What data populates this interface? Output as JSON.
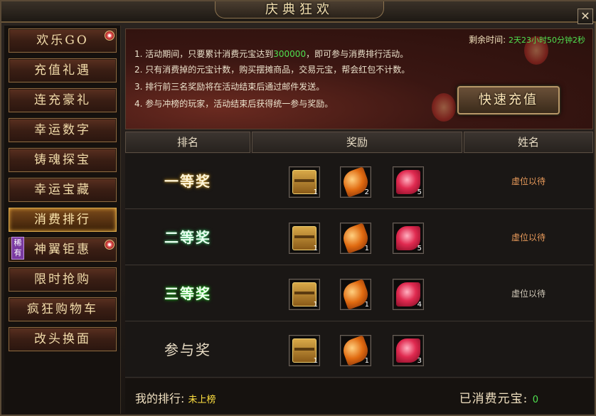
{
  "window": {
    "title": "庆典狂欢",
    "close_label": "✕"
  },
  "sidebar": {
    "items": [
      {
        "label": "欢乐GO",
        "dot": true
      },
      {
        "label": "充值礼遇"
      },
      {
        "label": "连充豪礼"
      },
      {
        "label": "幸运数字"
      },
      {
        "label": "铸魂探宝"
      },
      {
        "label": "幸运宝藏"
      },
      {
        "label": "消费排行",
        "active": true
      },
      {
        "label": "神翼钜惠",
        "dot": true,
        "tag": "稀有"
      },
      {
        "label": "限时抢购"
      },
      {
        "label": "疯狂购物车"
      },
      {
        "label": "改头换面"
      }
    ]
  },
  "banner": {
    "rules": [
      {
        "pre": "1. 活动期间，只要累计消费元宝达到",
        "hl": "300000",
        "post": "，即可参与消费排行活动。"
      },
      {
        "pre": "2. 只有消费掉的元宝计数，购买摆摊商品，交易元宝，帮会红包不计数。",
        "hl": "",
        "post": ""
      },
      {
        "pre": "3. 排行前三名奖励将在活动结束后通过邮件发送。",
        "hl": "",
        "post": ""
      },
      {
        "pre": "4. 参与冲榜的玩家，活动结束后获得统一参与奖励。",
        "hl": "",
        "post": ""
      }
    ],
    "remain_label": "剩余时间:",
    "remain_value": "2天23小时50分钟2秒",
    "recharge_label": "快速充值"
  },
  "table": {
    "headers": [
      "排名",
      "奖励",
      "姓名"
    ],
    "rows": [
      {
        "rank": "一等奖",
        "items": [
          {
            "icon": "treasure-chest-icon",
            "count": "1"
          },
          {
            "icon": "amber-gem-icon",
            "count": "2"
          },
          {
            "icon": "rose-crystal-icon",
            "count": "5"
          }
        ],
        "name": "虚位以待"
      },
      {
        "rank": "二等奖",
        "items": [
          {
            "icon": "treasure-chest-icon",
            "count": "1"
          },
          {
            "icon": "amber-gem-icon",
            "count": "1"
          },
          {
            "icon": "rose-crystal-icon",
            "count": "5"
          }
        ],
        "name": "虚位以待"
      },
      {
        "rank": "三等奖",
        "items": [
          {
            "icon": "golden-chest-icon",
            "count": "1"
          },
          {
            "icon": "amber-gem-icon",
            "count": "1"
          },
          {
            "icon": "rose-crystal-icon",
            "count": "4"
          }
        ],
        "name": "虚位以待"
      },
      {
        "rank": "参与奖",
        "items": [
          {
            "icon": "golden-chest-icon",
            "count": "1"
          },
          {
            "icon": "amber-gem-icon",
            "count": "1"
          },
          {
            "icon": "rose-crystal-icon",
            "count": "3"
          }
        ],
        "name": ""
      }
    ]
  },
  "footer": {
    "my_rank_label": "我的排行:",
    "my_rank_value": "未上榜",
    "spent_label": "已消费元宝:",
    "spent_value": "0"
  }
}
